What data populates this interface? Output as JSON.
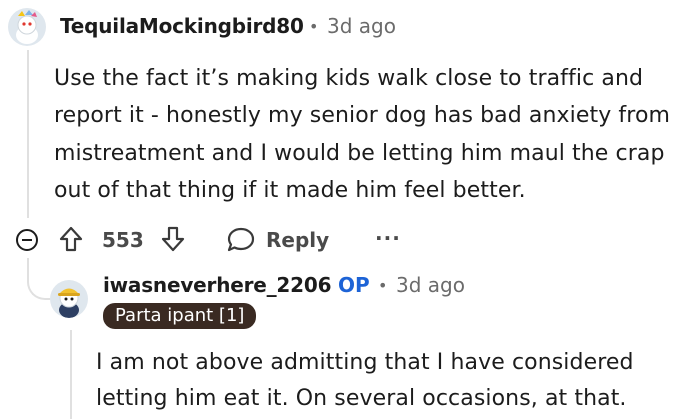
{
  "comment": {
    "username": "TequilaMockingbird80",
    "time": "3d ago",
    "separator": "•",
    "body_lines": [
      "Use the fact it’s making kids walk close to traffic and",
      "report it - honestly my senior dog has bad anxiety from",
      "mistreatment and I would be letting him maul the crap",
      "out of that thing if it made him feel better."
    ],
    "upvotes": "553",
    "reply_label": "Reply",
    "more_label": "···"
  },
  "reply": {
    "username": "iwasneverhere_2206",
    "op_badge": "OP",
    "separator": "•",
    "time": "3d ago",
    "flair": "Parta  ipant [1]",
    "body_lines": [
      "I am not above admitting that I have considered",
      "letting him eat it. On several occasions, at that."
    ]
  },
  "icons": {
    "collapse": "collapse-icon",
    "upvote": "upvote-icon",
    "downvote": "downvote-icon",
    "reply": "reply-icon"
  }
}
